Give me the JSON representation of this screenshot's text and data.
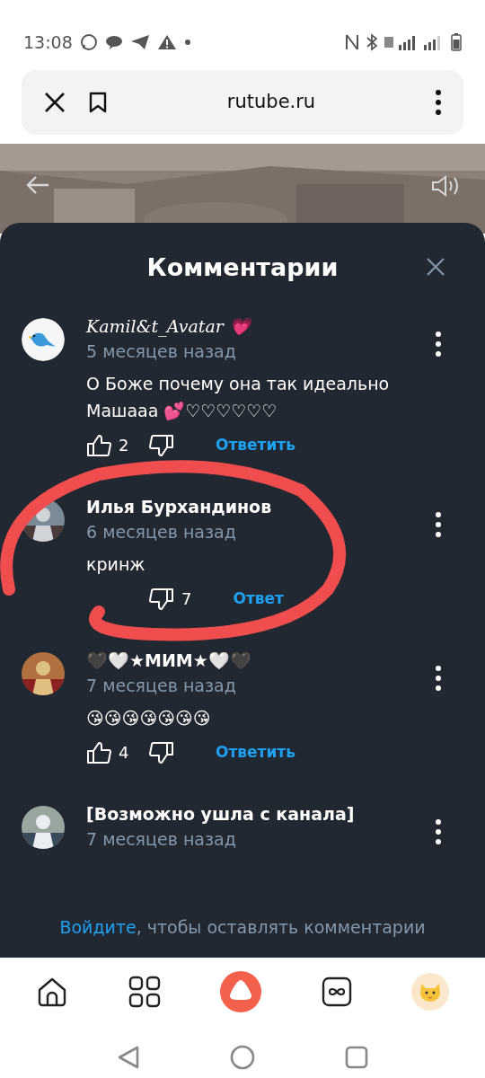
{
  "status_bar": {
    "time": "13:08"
  },
  "browser_bar": {
    "url": "rutube.ru"
  },
  "sheet": {
    "title": "Комментарии",
    "comments": [
      {
        "author": "Kamil&t_Avatar 💗",
        "kind": "bird",
        "time": "5 месяцев назад",
        "body": "О Боже почему она так идеально Машааа 💕♡♡♡♡♡♡",
        "likes": "2",
        "reply": "Ответить"
      },
      {
        "author": "Илья Бурхандинов",
        "time": "6 месяцев назад",
        "body": "кринж",
        "dislikes": "7",
        "reply": "Ответ",
        "circled": true
      },
      {
        "author": "🖤🤍★МИМ★🤍🖤",
        "time": "7 месяцев назад",
        "body": "😘😘😘😘😘😘😘",
        "likes": "4",
        "reply": "Ответить"
      },
      {
        "author": "[Возможно ушла с канала]",
        "time": "7 месяцев назад"
      }
    ],
    "login_link": "Войдите",
    "login_text": ", чтобы оставлять комментарии"
  }
}
